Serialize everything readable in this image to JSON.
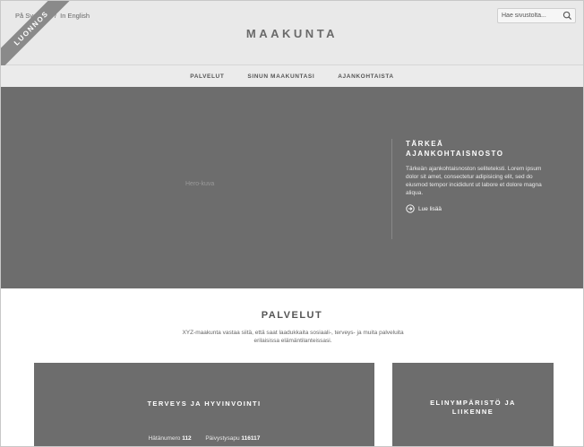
{
  "header": {
    "languages": [
      "På Svenska",
      "In English"
    ],
    "separator": "/",
    "logo": "MAAKUNTA",
    "search_placeholder": "Hae sivustolta...",
    "draft_ribbon": "LUONNOS"
  },
  "nav": {
    "items": [
      "PALVELUT",
      "SINUN MAAKUNTASI",
      "AJANKOHTAISTA"
    ]
  },
  "hero": {
    "image_placeholder": "Hero-kuva",
    "news_title": "TÄRKEÄ AJANKOHTAISNOSTO",
    "news_body": "Tärkeän ajankohtaisnoston seliteteksti. Lorem ipsum dolor sit amet, consectetur adipisicing elit, sed do eiusmod tempor incididunt ut labore et dolore magna aliqua.",
    "read_more": "Lue lisää"
  },
  "services": {
    "title": "PALVELUT",
    "description": "XYZ-maakunta vastaa siitä, että saat laadukkaita sosiaali-, terveys- ja muita palveluita erilaisissa elämäntilanteissasi.",
    "cards": [
      {
        "title": "TERVEYS JA HYVINVOINTI",
        "emergency_label": "Hätänumero",
        "emergency_number": "112",
        "duty_label": "Päivystysapu",
        "duty_number": "116117"
      },
      {
        "title": "ELINYMPÄRISTÖ JA LIIKENNE"
      }
    ]
  },
  "colors": {
    "header_bg": "#e9e9e9",
    "hero_bg": "#6d6d6d",
    "ribbon_bg": "#8a8a8a"
  },
  "icons": [
    "search-icon",
    "arrow-circle-icon"
  ]
}
